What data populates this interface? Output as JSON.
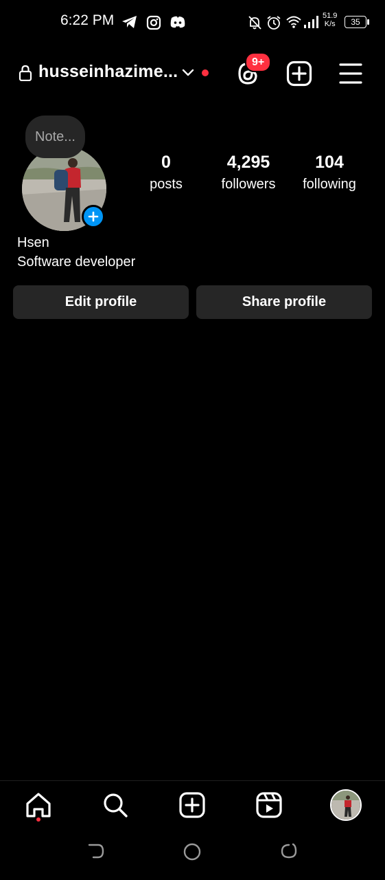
{
  "status_bar": {
    "time": "6:22 PM",
    "net_speed_value": "51.9",
    "net_speed_unit": "K/s",
    "battery": "35"
  },
  "header": {
    "username": "husseinhazime...",
    "threads_badge": "9+"
  },
  "profile": {
    "note_placeholder": "Note...",
    "stats": [
      {
        "value": "0",
        "label": "posts"
      },
      {
        "value": "4,295",
        "label": "followers"
      },
      {
        "value": "104",
        "label": "following"
      }
    ],
    "name": "Hsen",
    "bio": "Software developer",
    "buttons": {
      "edit": "Edit profile",
      "share": "Share profile"
    }
  },
  "colors": {
    "background": "#000000",
    "surface": "#262626",
    "accent_blue": "#0095f6",
    "notification_red": "#ff3040"
  },
  "icons": {
    "status": [
      "telegram-icon",
      "instagram-icon",
      "discord-icon",
      "mute-bell-icon",
      "alarm-icon",
      "wifi-icon",
      "signal-icon",
      "battery-icon"
    ],
    "header": [
      "lock-icon",
      "chevron-down-icon",
      "threads-icon",
      "create-plus-icon",
      "menu-icon"
    ],
    "nav": [
      "home-icon",
      "search-icon",
      "new-post-icon",
      "reels-icon",
      "profile-avatar"
    ],
    "system": [
      "back-icon",
      "home-circle-icon",
      "recents-icon"
    ]
  }
}
